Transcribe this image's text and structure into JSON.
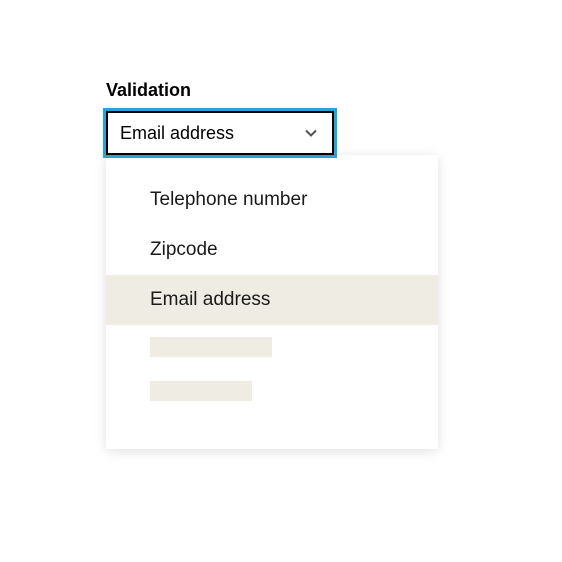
{
  "label": "Validation",
  "select": {
    "value": "Email address"
  },
  "dropdown": {
    "options": [
      {
        "label": "Telephone number",
        "highlighted": false
      },
      {
        "label": "Zipcode",
        "highlighted": false
      },
      {
        "label": "Email address",
        "highlighted": true
      }
    ]
  },
  "colors": {
    "focus_ring": "#29a3d5",
    "highlight_bg": "#efece4"
  }
}
